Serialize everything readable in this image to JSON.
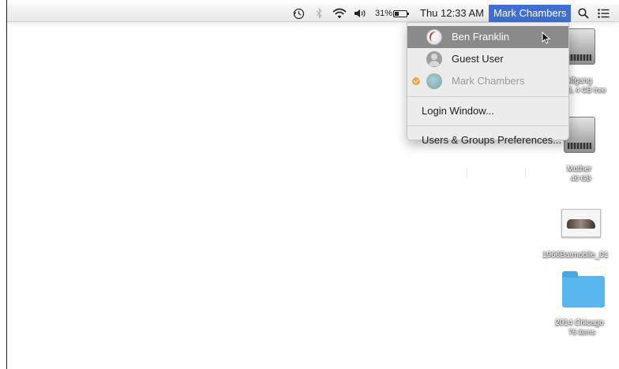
{
  "menubar": {
    "icons": [
      "time-machine-icon",
      "bluetooth-icon",
      "wifi-icon",
      "volume-icon",
      "battery-icon",
      "spotlight-icon",
      "notification-center-icon"
    ],
    "battery_percent": "31%",
    "clock": "Thu 12:33 AM",
    "user_name": "Mark Chambers",
    "highlight_color": "#3e6fd6"
  },
  "user_menu": {
    "users": [
      {
        "name": "Ben Franklin",
        "icon": "baseball-avatar",
        "state": "highlighted"
      },
      {
        "name": "Guest User",
        "icon": "guest-avatar",
        "state": "normal"
      },
      {
        "name": "Mark Chambers",
        "icon": "globe-avatar",
        "state": "current"
      }
    ],
    "login_window": "Login Window...",
    "users_groups_prefs": "Users & Groups Preferences..."
  },
  "desktop": {
    "icons": [
      {
        "name": "olfgang",
        "sub": "GB, 4 GB free",
        "type": "hard-drive"
      },
      {
        "name": "Mother",
        "sub": "40 GB",
        "type": "hard-drive"
      },
      {
        "name": "1966Batmobile_01",
        "sub": "",
        "type": "image"
      },
      {
        "name": "2014 Chicago",
        "sub": "76 items",
        "type": "folder"
      }
    ]
  }
}
